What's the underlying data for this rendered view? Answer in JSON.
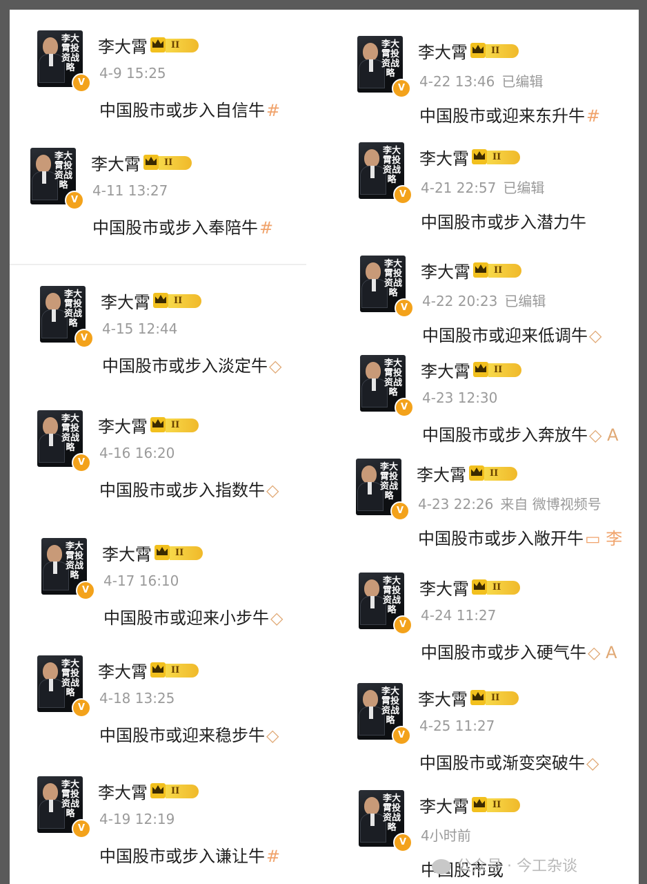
{
  "colors": {
    "verified": "#f3a21b",
    "badge": "#f2c01e",
    "timestamp": "#9a9a9a",
    "text": "#1f1f1f"
  },
  "profile": {
    "name": "李大霄",
    "avatar_title": "李大霄投资战略",
    "badge_level": "II"
  },
  "left_posts": [
    {
      "time": "4-9 15:25",
      "text": "中国股市或步入自信牛",
      "tail": "#"
    },
    {
      "time": "4-11 13:27",
      "text": "中国股市或步入奉陪牛",
      "tail": "#"
    },
    {
      "time": "4-15 12:44",
      "text": "中国股市或步入淡定牛",
      "tail": "◇"
    },
    {
      "time": "4-16 16:20",
      "text": "中国股市或步入指数牛",
      "tail": "◇"
    },
    {
      "time": "4-17 16:10",
      "text": "中国股市或迎来小步牛",
      "tail": "◇"
    },
    {
      "time": "4-18 13:25",
      "text": "中国股市或迎来稳步牛",
      "tail": "◇"
    },
    {
      "time": "4-19 12:19",
      "text": "中国股市或步入谦让牛",
      "tail": "#"
    }
  ],
  "right_posts": [
    {
      "time": "4-22 13:46",
      "edited": "已编辑",
      "text": "中国股市或迎来东升牛",
      "tail": "#"
    },
    {
      "time": "4-21 22:57",
      "edited": "已编辑",
      "text": "中国股市或步入潜力牛",
      "tail": ""
    },
    {
      "time": "4-22 20:23",
      "edited": "已编辑",
      "text": "中国股市或迎来低调牛",
      "tail": "◇"
    },
    {
      "time": "4-23 12:30",
      "edited": "",
      "text": "中国股市或步入奔放牛",
      "tail": "◇ A"
    },
    {
      "time": "4-23 22:26",
      "edited": "来自 微博视频号",
      "text": "中国股市或步入敞开牛",
      "tail": "▭ 李"
    },
    {
      "time": "4-24 11:27",
      "edited": "",
      "text": "中国股市或步入硬气牛",
      "tail": "◇ A"
    },
    {
      "time": "4-25 11:27",
      "edited": "",
      "text": "中国股市或渐变突破牛",
      "tail": "◇"
    },
    {
      "time": "4小时前",
      "edited": "",
      "text": "中国股市或",
      "tail": ""
    }
  ],
  "watermark": "公众号 · 今工杂谈"
}
